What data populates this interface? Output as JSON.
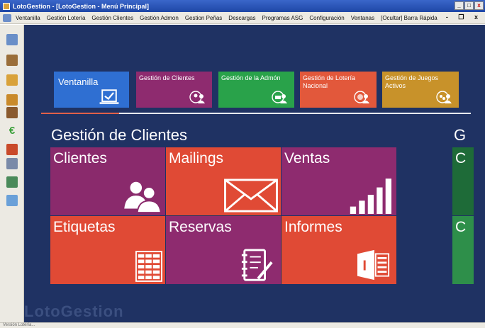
{
  "window": {
    "title": "LotoGestion - [LotoGestion - Menú Principal]",
    "controls": [
      "_",
      "□",
      "x"
    ]
  },
  "menubar": {
    "items": [
      "Ventanilla",
      "Gestión Lotería",
      "Gestión Clientes",
      "Gestión Admon",
      "Gestion Peñas",
      "Descargas",
      "Programas ASG",
      "Configuración",
      "Ventanas",
      "[Ocultar] Barra Rápida"
    ],
    "mdi_controls": "- ❐ x"
  },
  "sidebar": {
    "icons": [
      "people-icon",
      "store-icon",
      "puzzle-icon",
      "box-icon",
      "store-icon",
      "euro-icon",
      "tree-icon",
      "calendar-icon",
      "calculator-icon",
      "document-icon"
    ],
    "colors": [
      "#6a8fc8",
      "#9a6e3a",
      "#d9a23a",
      "#c98a2a",
      "#8a5a2e",
      "#e8c400",
      "#c94a2a",
      "#7a8aa8",
      "#4a8a5a",
      "#6aa0d8"
    ]
  },
  "top_tiles": [
    {
      "label": "Ventanilla",
      "color": "#2f6fd2"
    },
    {
      "label": "Gestión de Clientes",
      "color": "#8e2b6f"
    },
    {
      "label": "Gestión de la Admón",
      "color": "#29a24a"
    },
    {
      "label": "Gestión de Lotería Nacional",
      "color": "#e2583b"
    },
    {
      "label": "Gestión de Juegos Activos",
      "color": "#c8922a"
    }
  ],
  "section": {
    "title": "Gestión de Clientes",
    "title_right": "G"
  },
  "tiles": [
    {
      "label": "Clientes",
      "color": "#8a2a6c",
      "icon": "users-icon"
    },
    {
      "label": "Mailings",
      "color": "#e04a35",
      "icon": "envelope-icon"
    },
    {
      "label": "Ventas",
      "color": "#8e2b6f",
      "icon": "bar-chart-icon"
    },
    {
      "label": "Etiquetas",
      "color": "#e04a35",
      "icon": "table-icon"
    },
    {
      "label": "Reservas",
      "color": "#8e2b6f",
      "icon": "notebook-pen-icon"
    },
    {
      "label": "Informes",
      "color": "#e04a35",
      "icon": "office-doc-icon"
    }
  ],
  "right_tiles": [
    {
      "label": "C",
      "color": "#1e6b38"
    },
    {
      "label": "C",
      "color": "#2e8f4a"
    }
  ],
  "logo": "LotoGestion",
  "status": "Versión Lotería..."
}
